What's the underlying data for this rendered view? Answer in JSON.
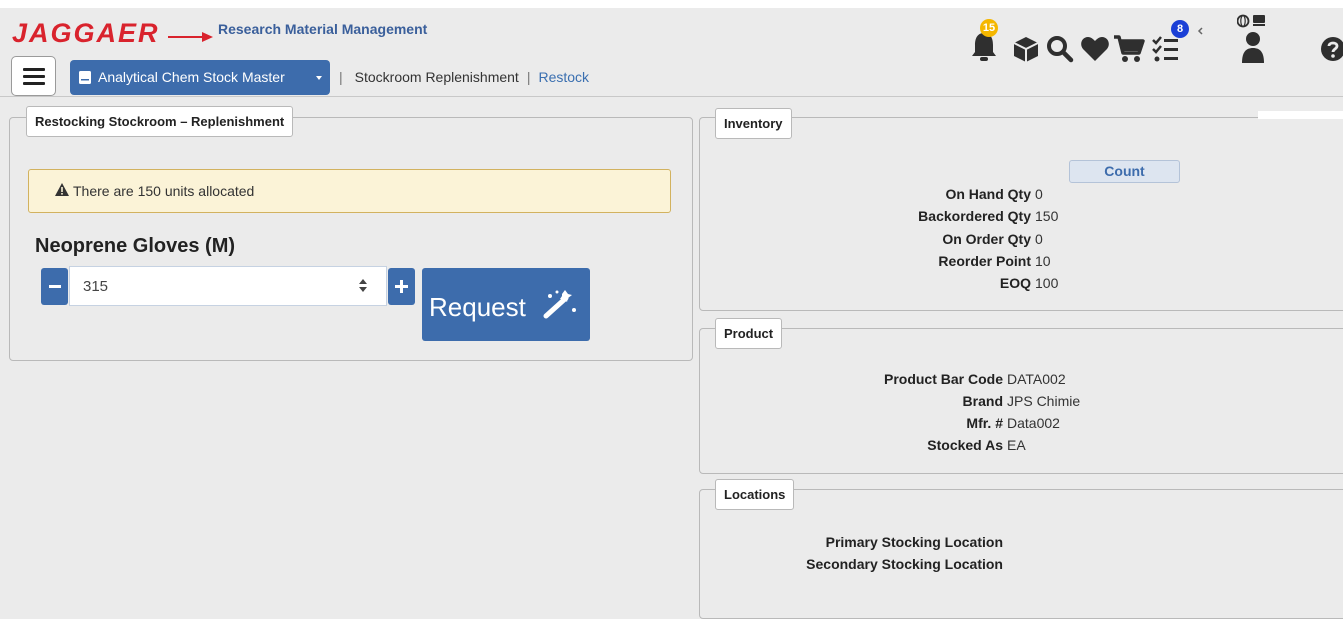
{
  "header": {
    "logo_text": "JAGGAER",
    "app_title": "Research Material Management",
    "notifications_count": "15",
    "tasks_count": "8"
  },
  "nav": {
    "stock_selector": "Analytical Chem Stock Master",
    "breadcrumb_sep": "|",
    "breadcrumb_page": "Stockroom Replenishment",
    "breadcrumb_link": "Restock"
  },
  "restock": {
    "panel_title": "Restocking Stockroom – Replenishment",
    "alert_text": "There are 150 units allocated",
    "product_name": "Neoprene Gloves (M)",
    "quantity_value": "315",
    "request_label": "Request"
  },
  "inventory": {
    "panel_title": "Inventory",
    "count_button": "Count",
    "rows": [
      {
        "label": "On Hand Qty",
        "value": "0"
      },
      {
        "label": "Backordered Qty",
        "value": "150"
      },
      {
        "label": "On Order Qty",
        "value": "0"
      },
      {
        "label": "Reorder Point",
        "value": "10"
      },
      {
        "label": "EOQ",
        "value": "100"
      }
    ]
  },
  "product": {
    "panel_title": "Product",
    "rows": [
      {
        "label": "Product Bar Code",
        "value": "DATA002"
      },
      {
        "label": "Brand",
        "value": "JPS Chimie"
      },
      {
        "label": "Mfr. #",
        "value": "Data002"
      },
      {
        "label": "Stocked As",
        "value": "EA"
      }
    ]
  },
  "locations": {
    "panel_title": "Locations",
    "rows": [
      {
        "label": "Primary Stocking Location",
        "value": ""
      },
      {
        "label": "Secondary Stocking Location",
        "value": ""
      }
    ]
  },
  "colors": {
    "brand_red": "#d9232d",
    "primary_blue": "#3d6cac",
    "alert_bg": "#fbf3d7",
    "badge_yellow": "#f5b700",
    "badge_blue": "#1a3fd6"
  }
}
